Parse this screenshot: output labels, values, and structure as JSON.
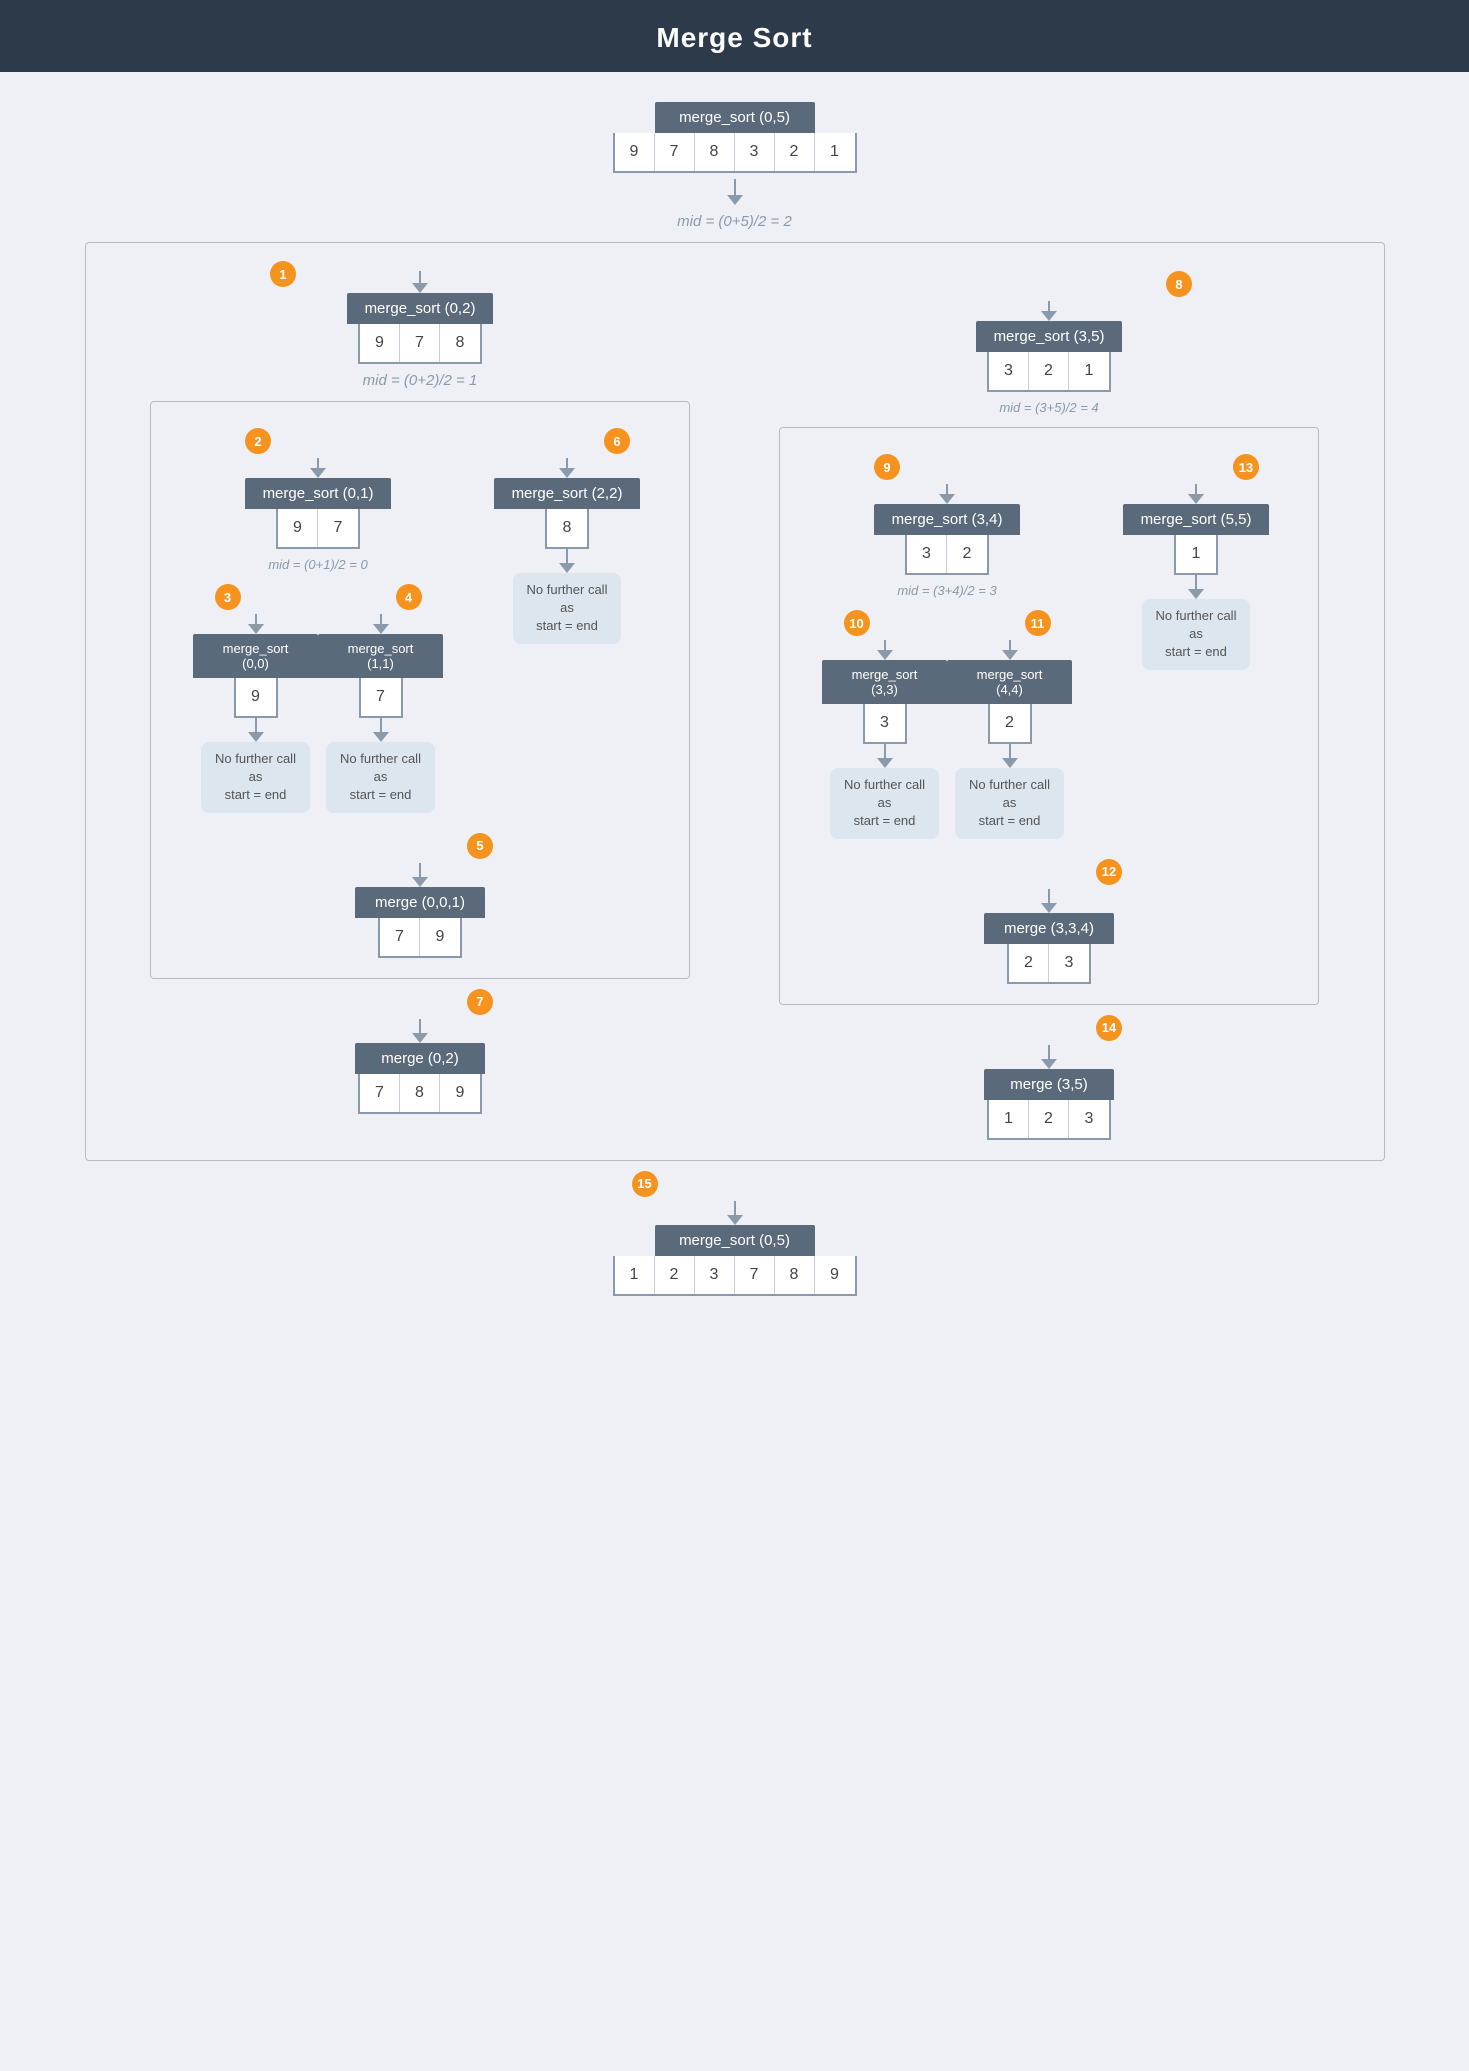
{
  "title": "Merge Sort",
  "nodes": {
    "root": {
      "label": "merge_sort (0,5)",
      "values": [
        9,
        7,
        8,
        3,
        2,
        1
      ]
    },
    "mid_root": "mid = (0+5)/2 = 2",
    "n1": {
      "label": "merge_sort (0,2)",
      "values": [
        9,
        7,
        8
      ],
      "badge": "1"
    },
    "n8": {
      "label": "merge_sort (3,5)",
      "values": [
        3,
        2,
        1
      ],
      "badge": "8"
    },
    "mid_left": "mid = (0+2)/2 = 1",
    "mid_right": "mid = (3+5)/2 = 4",
    "n2": {
      "label": "merge_sort (0,1)",
      "values": [
        9,
        7
      ],
      "badge": "2"
    },
    "n6": {
      "label": "merge_sort (2,2)",
      "values": [
        8
      ],
      "badge": "6"
    },
    "n9": {
      "label": "merge_sort (3,4)",
      "values": [
        3,
        2
      ],
      "badge": "9"
    },
    "n13": {
      "label": "merge_sort (5,5)",
      "values": [
        1
      ],
      "badge": "13"
    },
    "mid_n2": "mid = (0+1)/2 = 0",
    "mid_n9": "mid = (3+4)/2 = 3",
    "n3": {
      "label": "merge_sort (0,0)",
      "values": [
        9
      ],
      "badge": "3"
    },
    "n4": {
      "label": "merge_sort (1,1)",
      "values": [
        7
      ],
      "badge": "4"
    },
    "n10": {
      "label": "merge_sort (3,3)",
      "values": [
        3
      ],
      "badge": "10"
    },
    "n11": {
      "label": "merge_sort (4,4)",
      "values": [
        2
      ],
      "badge": "11"
    },
    "no_further_n6": "No further call\nas start = end",
    "no_further_n13": "No further call\nas start = end",
    "no_further_n3": "No further call\nas start = end",
    "no_further_n4": "No further call\nas start = end",
    "no_further_n10": "No further call\nas start = end",
    "no_further_n11": "No further call\nas start = end",
    "n5": {
      "label": "merge (0,0,1)",
      "values": [
        7,
        9
      ],
      "badge": "5"
    },
    "n12": {
      "label": "merge (3,3,4)",
      "values": [
        2,
        3
      ],
      "badge": "12"
    },
    "n7": {
      "label": "merge (0,2)",
      "values": [
        7,
        8,
        9
      ],
      "badge": "7"
    },
    "n14": {
      "label": "merge (3,5)",
      "values": [
        1,
        2,
        3
      ],
      "badge": "14"
    },
    "n15": {
      "label": "merge_sort (0,5)",
      "values": [
        1,
        2,
        3,
        7,
        8,
        9
      ],
      "badge": "15"
    }
  }
}
